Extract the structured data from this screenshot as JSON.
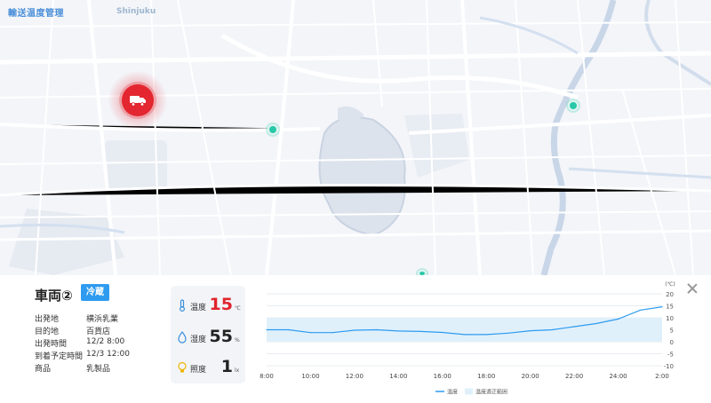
{
  "app": {
    "title": "輸送温度管理"
  },
  "map": {
    "place_label": "Shinjuku"
  },
  "vehicle": {
    "name": "車両②",
    "storage_type": "冷蔵",
    "info": [
      {
        "label": "出発地",
        "value": "横浜乳業"
      },
      {
        "label": "目的地",
        "value": "百貨店"
      },
      {
        "label": "出発時間",
        "value": "12/2 8:00"
      },
      {
        "label": "到着予定時間",
        "value": "12/3 12:00"
      },
      {
        "label": "商品",
        "value": "乳製品"
      }
    ]
  },
  "sensors": [
    {
      "label": "温度",
      "value": "15",
      "unit": "℃",
      "icon": "thermometer-icon"
    },
    {
      "label": "湿度",
      "value": "55",
      "unit": "%",
      "icon": "water-drop-icon"
    },
    {
      "label": "照度",
      "value": "1",
      "unit": "lx",
      "icon": "light-bulb-icon"
    }
  ],
  "colors": {
    "accent": "#2e9bf0",
    "alert": "#e0242d",
    "station": "#28c7a8",
    "band": "#dff0fb",
    "line": "#2e9bf0"
  },
  "chart_data": {
    "type": "line",
    "categories": [
      "8:00",
      "10:00",
      "12:00",
      "14:00",
      "16:00",
      "18:00",
      "20:00",
      "22:00",
      "24:00",
      "2:00"
    ],
    "x": [
      8,
      9,
      10,
      11,
      12,
      13,
      14,
      15,
      16,
      17,
      18,
      19,
      20,
      21,
      22,
      23,
      24,
      25,
      26
    ],
    "series": [
      {
        "name": "温度",
        "values": [
          5,
          5,
          3.8,
          3.8,
          4.8,
          5,
          4.5,
          4.3,
          3.9,
          3,
          3,
          3.6,
          4.6,
          5,
          6.3,
          7.6,
          9.5,
          13.2,
          14.6
        ]
      }
    ],
    "band": {
      "name": "温度適正範囲",
      "low": 0,
      "high": 10
    },
    "y_unit": "(℃)",
    "y_ticks": [
      -10,
      -5,
      0,
      5,
      10,
      15,
      20
    ],
    "ylim": [
      -10,
      20
    ],
    "xlim": [
      8,
      26
    ],
    "grid": true,
    "legend": "bottom"
  }
}
